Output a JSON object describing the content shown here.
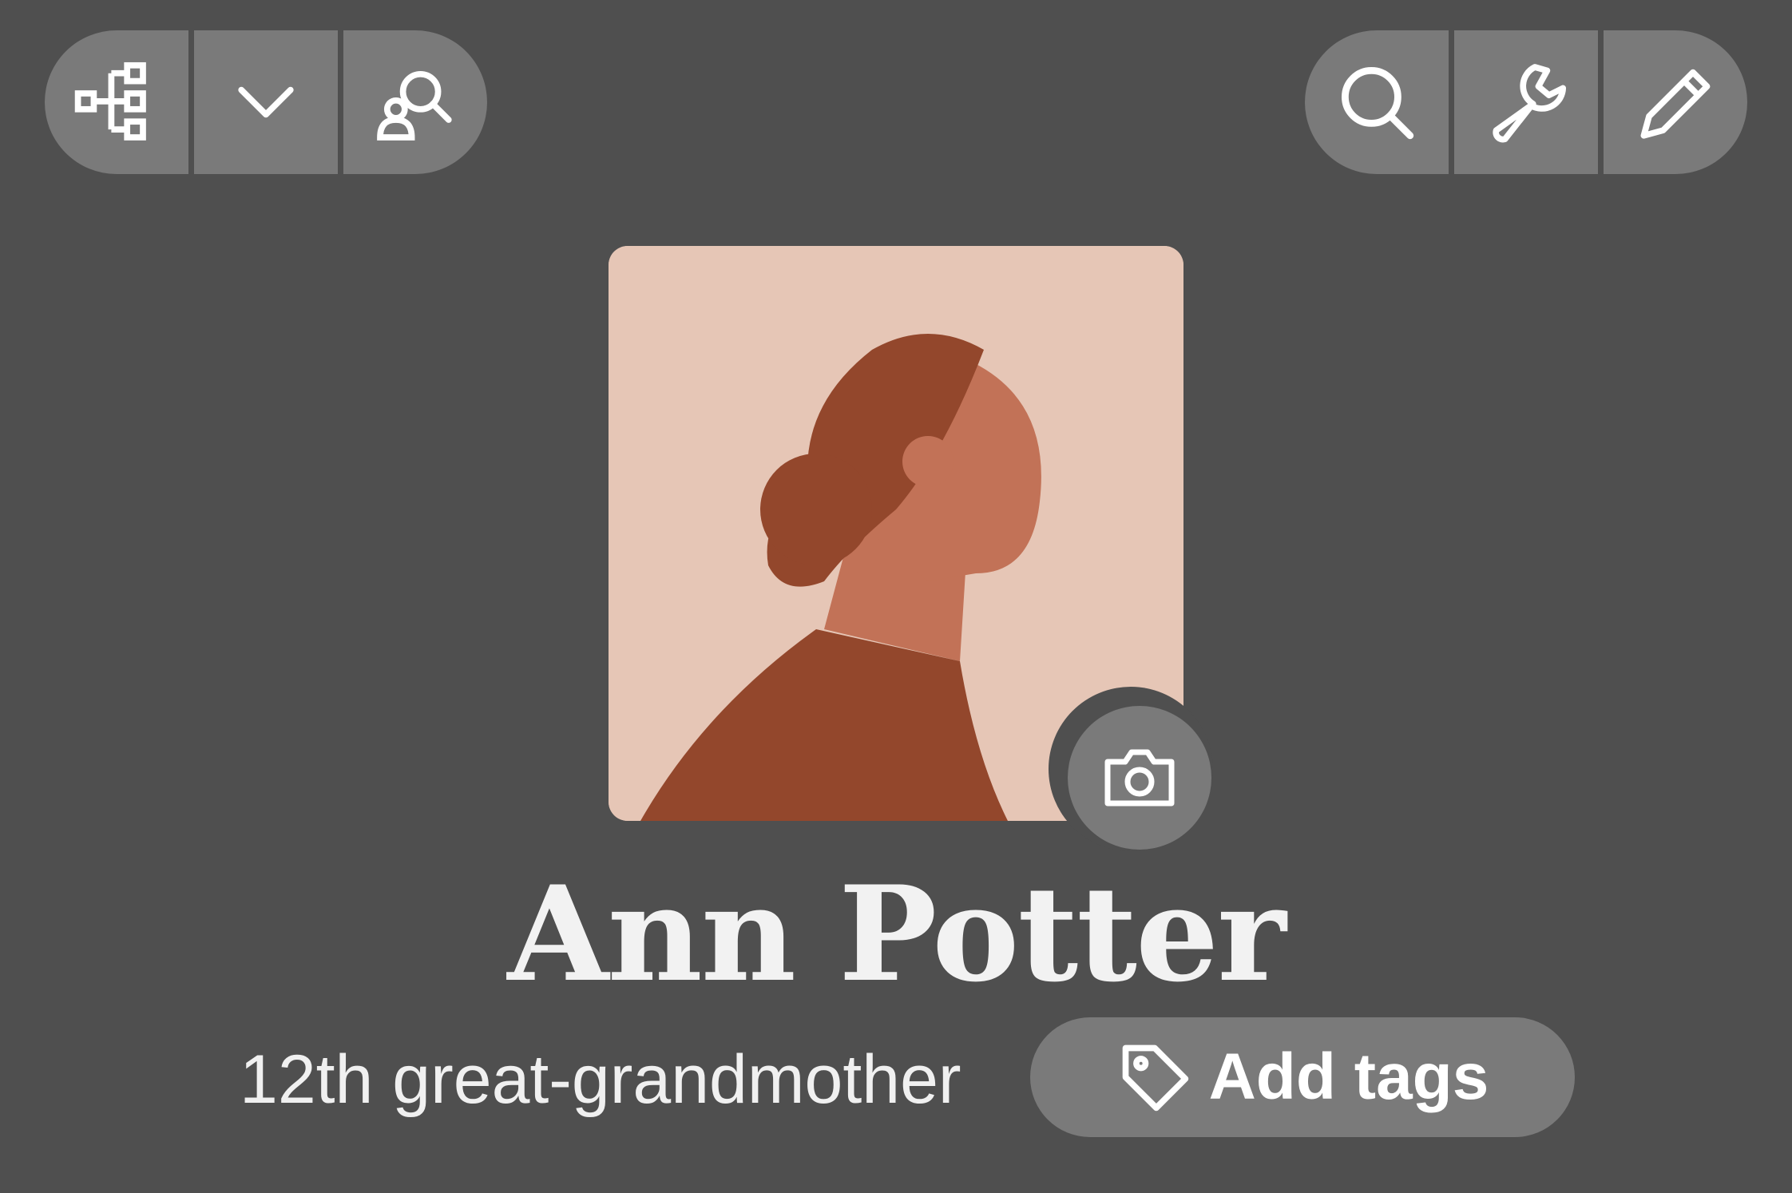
{
  "toolbar_left": {
    "buttons": [
      {
        "name": "tree-view-button",
        "icon": "family-tree-icon"
      },
      {
        "name": "expand-button",
        "icon": "chevron-down-icon"
      },
      {
        "name": "search-person-button",
        "icon": "person-search-icon"
      }
    ]
  },
  "toolbar_right": {
    "buttons": [
      {
        "name": "search-button",
        "icon": "search-icon"
      },
      {
        "name": "tools-button",
        "icon": "wrench-icon"
      },
      {
        "name": "edit-button",
        "icon": "pencil-icon"
      }
    ]
  },
  "profile": {
    "name": "Ann Potter",
    "relationship": "12th great-grandmother",
    "avatar_icon": "female-silhouette-avatar",
    "photo_button_icon": "camera-icon"
  },
  "tags": {
    "label": "Add tags",
    "icon": "tag-icon"
  },
  "colors": {
    "background": "#4f4f4f",
    "button": "#7a7a7a",
    "avatar_bg": "#e6c6b6",
    "hair": "#93472c",
    "skin": "#c27257",
    "text": "#f2f2f2"
  }
}
